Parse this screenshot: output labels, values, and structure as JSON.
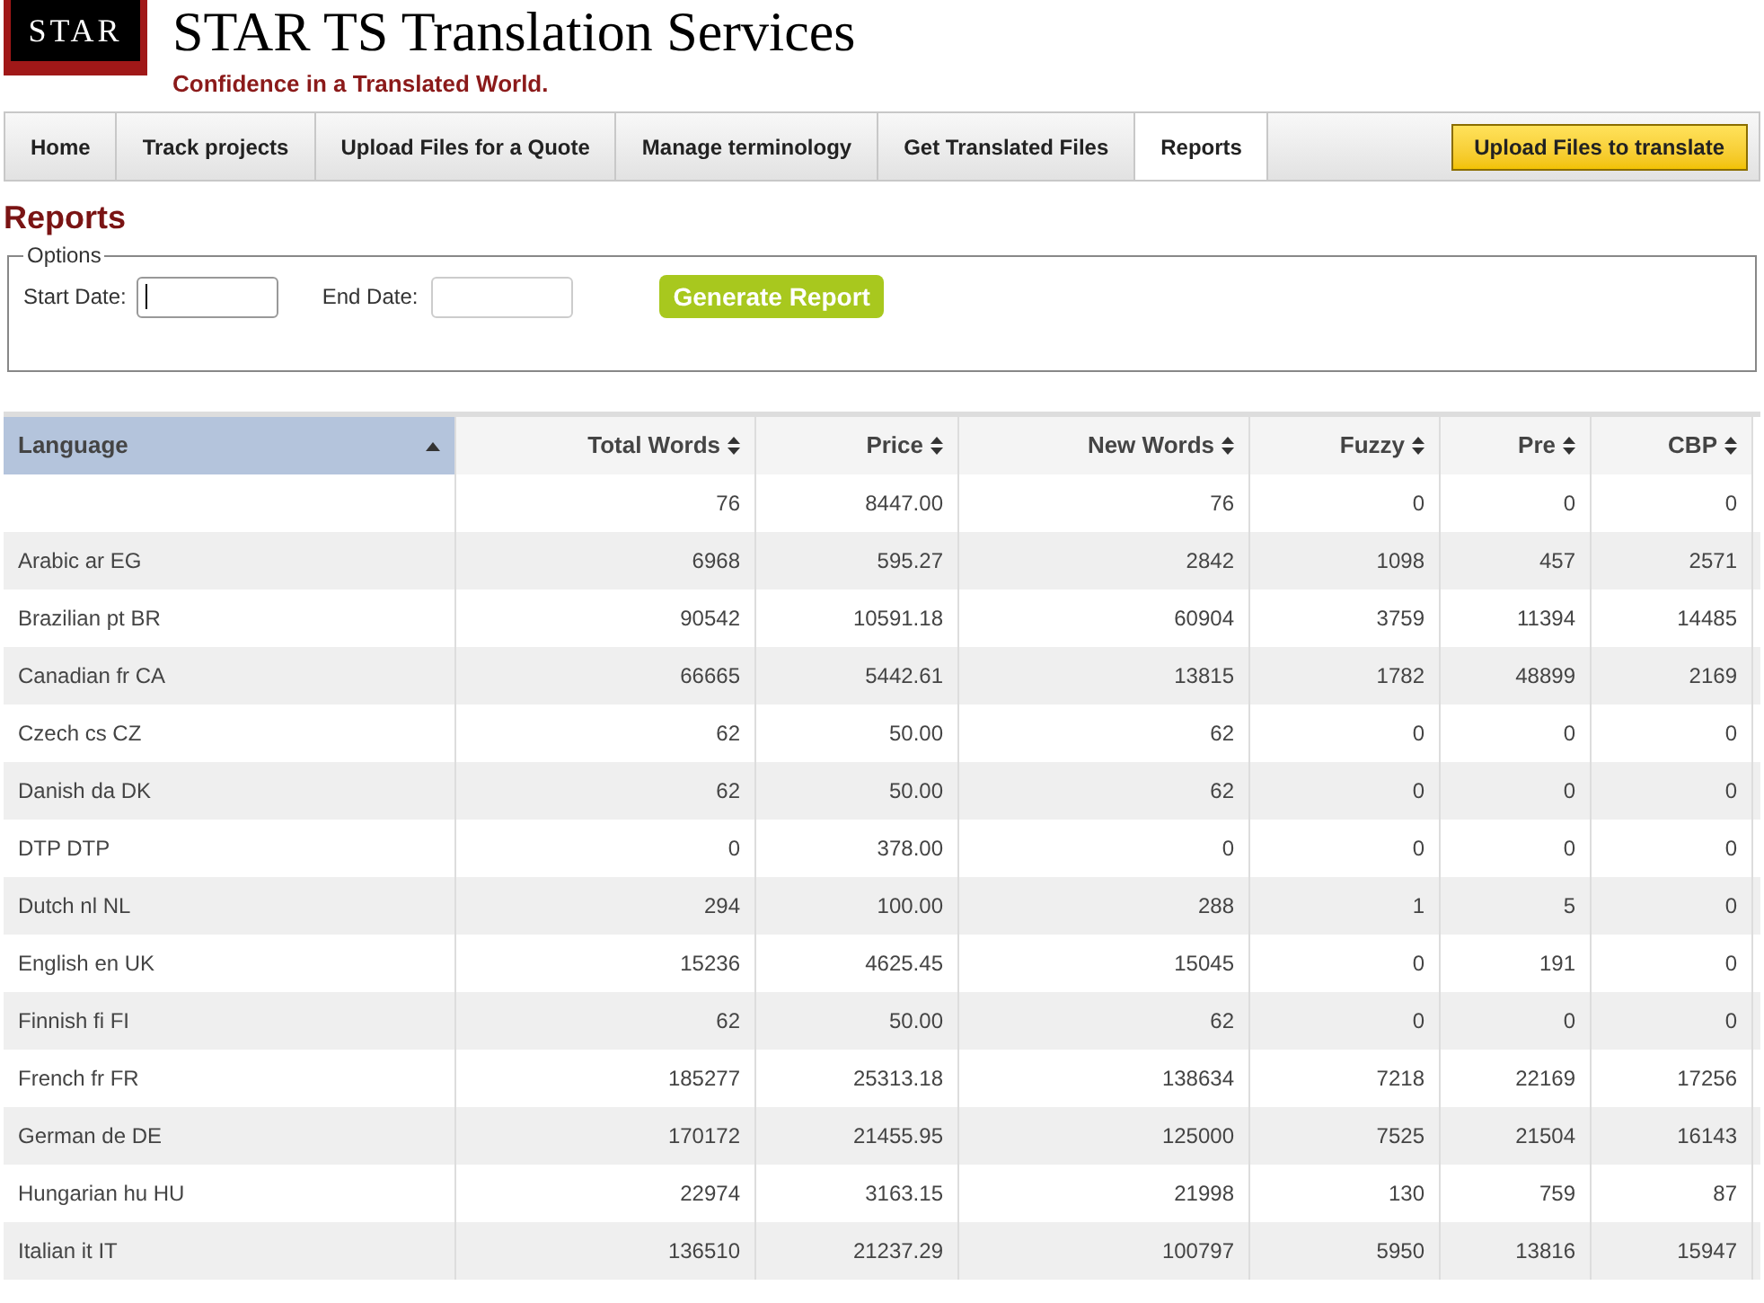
{
  "logo": {
    "text": "STAR"
  },
  "site": {
    "title": "STAR TS Translation Services",
    "tagline": "Confidence in a Translated World."
  },
  "nav": {
    "tabs": [
      {
        "label": "Home",
        "selected": false
      },
      {
        "label": "Track projects",
        "selected": false
      },
      {
        "label": "Upload Files for a Quote",
        "selected": false
      },
      {
        "label": "Manage terminology",
        "selected": false
      },
      {
        "label": "Get Translated Files",
        "selected": false
      },
      {
        "label": "Reports",
        "selected": true
      }
    ],
    "action_button": "Upload Files to translate"
  },
  "page_title": "Reports",
  "options": {
    "legend": "Options",
    "start_date": {
      "label": "Start Date:",
      "focused": true
    },
    "end_date": {
      "label": "End Date:",
      "focused": false
    },
    "button": "Generate Report"
  },
  "table": {
    "columns": [
      {
        "label": "Language",
        "sorted": true
      },
      {
        "label": "Total Words",
        "sorted": false
      },
      {
        "label": "Price",
        "sorted": false
      },
      {
        "label": "New Words",
        "sorted": false
      },
      {
        "label": "Fuzzy",
        "sorted": false
      },
      {
        "label": "Pre",
        "sorted": false
      },
      {
        "label": "CBP",
        "sorted": false
      }
    ],
    "rows": [
      [
        "",
        "76",
        "8447.00",
        "76",
        "0",
        "0",
        "0"
      ],
      [
        "Arabic ar EG",
        "6968",
        "595.27",
        "2842",
        "1098",
        "457",
        "2571"
      ],
      [
        "Brazilian pt BR",
        "90542",
        "10591.18",
        "60904",
        "3759",
        "11394",
        "14485"
      ],
      [
        "Canadian fr CA",
        "66665",
        "5442.61",
        "13815",
        "1782",
        "48899",
        "2169"
      ],
      [
        "Czech cs CZ",
        "62",
        "50.00",
        "62",
        "0",
        "0",
        "0"
      ],
      [
        "Danish da DK",
        "62",
        "50.00",
        "62",
        "0",
        "0",
        "0"
      ],
      [
        "DTP DTP",
        "0",
        "378.00",
        "0",
        "0",
        "0",
        "0"
      ],
      [
        "Dutch nl NL",
        "294",
        "100.00",
        "288",
        "1",
        "5",
        "0"
      ],
      [
        "English en UK",
        "15236",
        "4625.45",
        "15045",
        "0",
        "191",
        "0"
      ],
      [
        "Finnish fi FI",
        "62",
        "50.00",
        "62",
        "0",
        "0",
        "0"
      ],
      [
        "French fr FR",
        "185277",
        "25313.18",
        "138634",
        "7218",
        "22169",
        "17256"
      ],
      [
        "German de DE",
        "170172",
        "21455.95",
        "125000",
        "7525",
        "21504",
        "16143"
      ],
      [
        "Hungarian hu HU",
        "22974",
        "3163.15",
        "21998",
        "130",
        "759",
        "87"
      ],
      [
        "Italian it IT",
        "136510",
        "21237.29",
        "100797",
        "5950",
        "13816",
        "15947"
      ]
    ]
  }
}
